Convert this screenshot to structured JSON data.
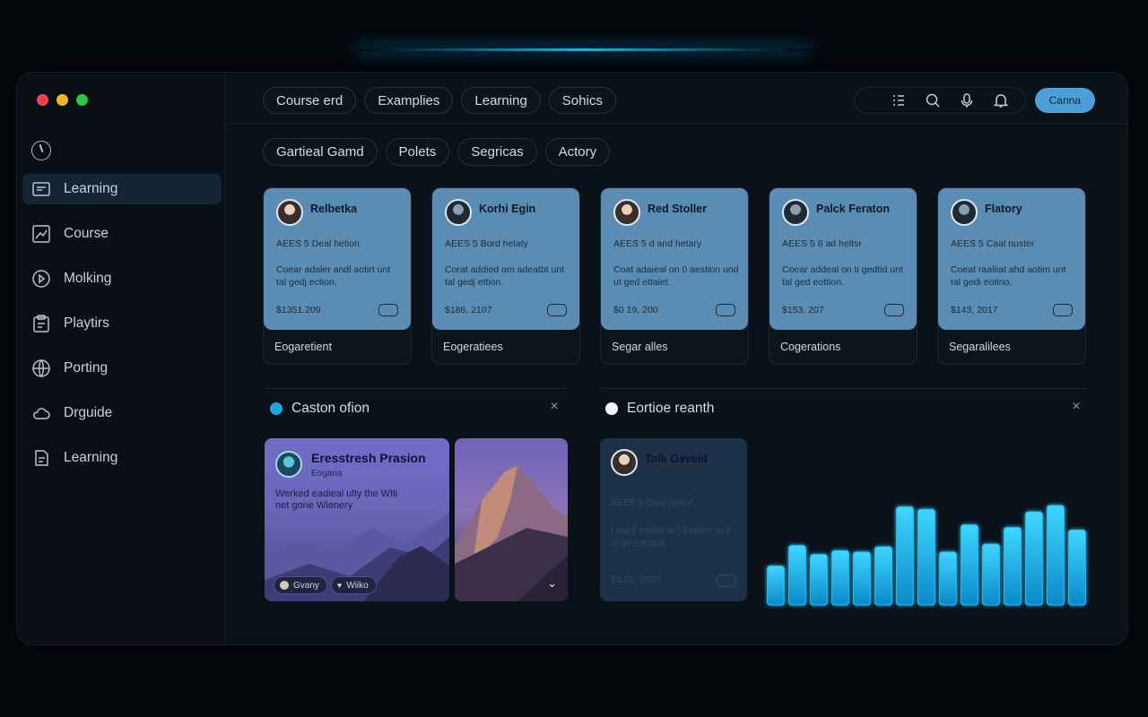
{
  "window": {
    "accent": "#4d9fd8",
    "glow": "#28d2ff"
  },
  "sidebar": {
    "items": [
      {
        "label": "Learning",
        "icon": "book-icon",
        "active": true
      },
      {
        "label": "Course",
        "icon": "chart-icon",
        "active": false
      },
      {
        "label": "Molking",
        "icon": "play-icon",
        "active": false
      },
      {
        "label": "Playtirs",
        "icon": "clipboard-icon",
        "active": false
      },
      {
        "label": "Porting",
        "icon": "globe-icon",
        "active": false
      },
      {
        "label": "Drguide",
        "icon": "cloud-icon",
        "active": false
      },
      {
        "label": "Learning",
        "icon": "document-icon",
        "active": false
      }
    ]
  },
  "header": {
    "tabs": [
      "Course erd",
      "Examplies",
      "Learning",
      "Sohics"
    ],
    "action_label": "Canna"
  },
  "filters": [
    "Gartieal Gamd",
    "Polets",
    "Segricas",
    "Actory"
  ],
  "cards": [
    {
      "name": "Relbetka",
      "sub": "AEES 5 Deal hetion",
      "desc": "Coear adaler andl aotirt unt tal gedj ection.",
      "price": "$1351.209",
      "footer": "Eogaretient"
    },
    {
      "name": "Korhi Egin",
      "sub": "AEES 5 Bord helaty",
      "desc": "Corat addied om adeatbt unt tal gedj ettion.",
      "price": "$186, 2107",
      "footer": "Eogeratiees"
    },
    {
      "name": "Red Stoller",
      "sub": "AEES 5 d and hetary",
      "desc": "Coat adaieal on 0 aestion und ut ged ettaiet.",
      "price": "$0 19, 200",
      "footer": "Segar alles"
    },
    {
      "name": "Palck Feraton",
      "sub": "AEES 5 6 ad heltsr",
      "desc": "Coear addeal on ti gedtid unt tal ged eottion.",
      "price": "$153, 207",
      "footer": "Cogerations"
    },
    {
      "name": "Flatory",
      "sub": "AEES 5 Caal nuster",
      "desc": "Coeat raaliiat ahd aotim unt tal gedi eotino.",
      "price": "$143, 2017",
      "footer": "Segaralilees"
    }
  ],
  "sections": {
    "left_title": "Caston ofion",
    "right_title": "Eortioe reanth",
    "left_dot": "#1fa6e0",
    "right_dot": "#f2f4f7"
  },
  "feature": {
    "title": "Eresstresh Prasion",
    "sub": "Eogaria",
    "desc": "Werked eadieal ulty the Wtli net gone Wienery",
    "chips": [
      "Gvany",
      "Wiiko"
    ]
  },
  "profile": {
    "name": "Tolk Geveid",
    "sub": "AEES 5 Deal heller",
    "desc": "Lased eaddil ard Fraiten unit ol gecl ection.",
    "price": "$1.55, 2097"
  },
  "chart_data": {
    "type": "bar",
    "values": [
      0.3,
      0.46,
      0.39,
      0.42,
      0.41,
      0.45,
      0.76,
      0.74,
      0.41,
      0.62,
      0.47,
      0.6,
      0.72,
      0.77,
      0.58
    ],
    "color": "#1ec8ff",
    "ylim": [
      0,
      1
    ]
  }
}
